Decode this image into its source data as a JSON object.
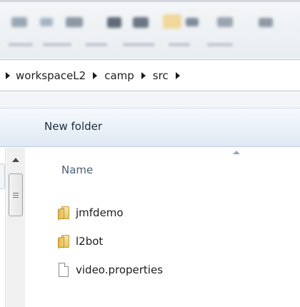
{
  "window": {
    "breadcrumb": [
      "workspaceL2",
      "camp",
      "src"
    ]
  },
  "command_bar": {
    "new_folder_label": "New folder"
  },
  "file_list": {
    "column_header": "Name",
    "sort": "ascending",
    "items": [
      {
        "name": "jmfdemo",
        "type": "folder",
        "icon": "folder-icon"
      },
      {
        "name": "l2bot",
        "type": "folder",
        "icon": "folder-icon"
      },
      {
        "name": "video.properties",
        "type": "file",
        "icon": "document-icon"
      }
    ]
  },
  "colors": {
    "header_text": "#4c607a",
    "command_bar_top": "#f6f9fd",
    "command_bar_bottom": "#dfe8f3",
    "folder_yellow": "#e6c86a"
  }
}
